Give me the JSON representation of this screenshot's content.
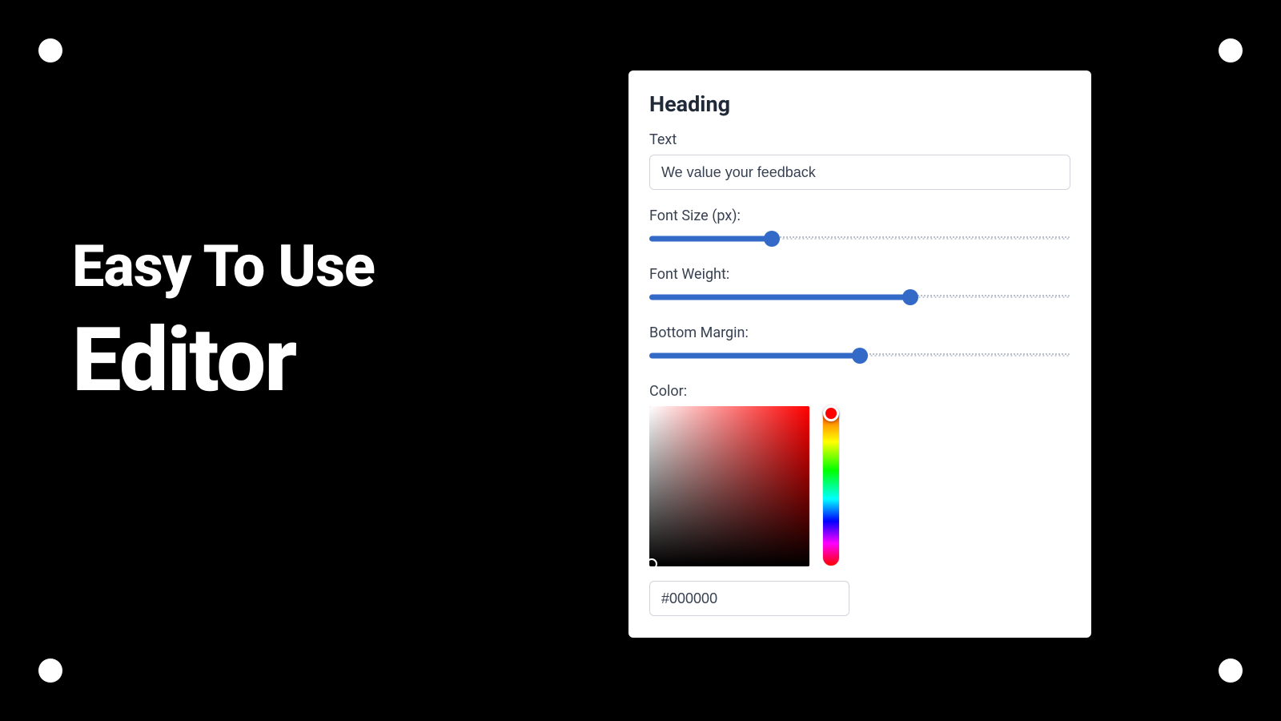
{
  "headline": {
    "line1": "Easy To Use",
    "line2": "Editor"
  },
  "panel": {
    "title": "Heading",
    "text_field": {
      "label": "Text",
      "value": "We value your feedback"
    },
    "sliders": {
      "font_size": {
        "label": "Font Size (px):",
        "percent": 29
      },
      "font_weight": {
        "label": "Font Weight:",
        "percent": 62
      },
      "bottom_margin": {
        "label": "Bottom Margin:",
        "percent": 50
      }
    },
    "color": {
      "label": "Color:",
      "hex": "#000000"
    }
  }
}
